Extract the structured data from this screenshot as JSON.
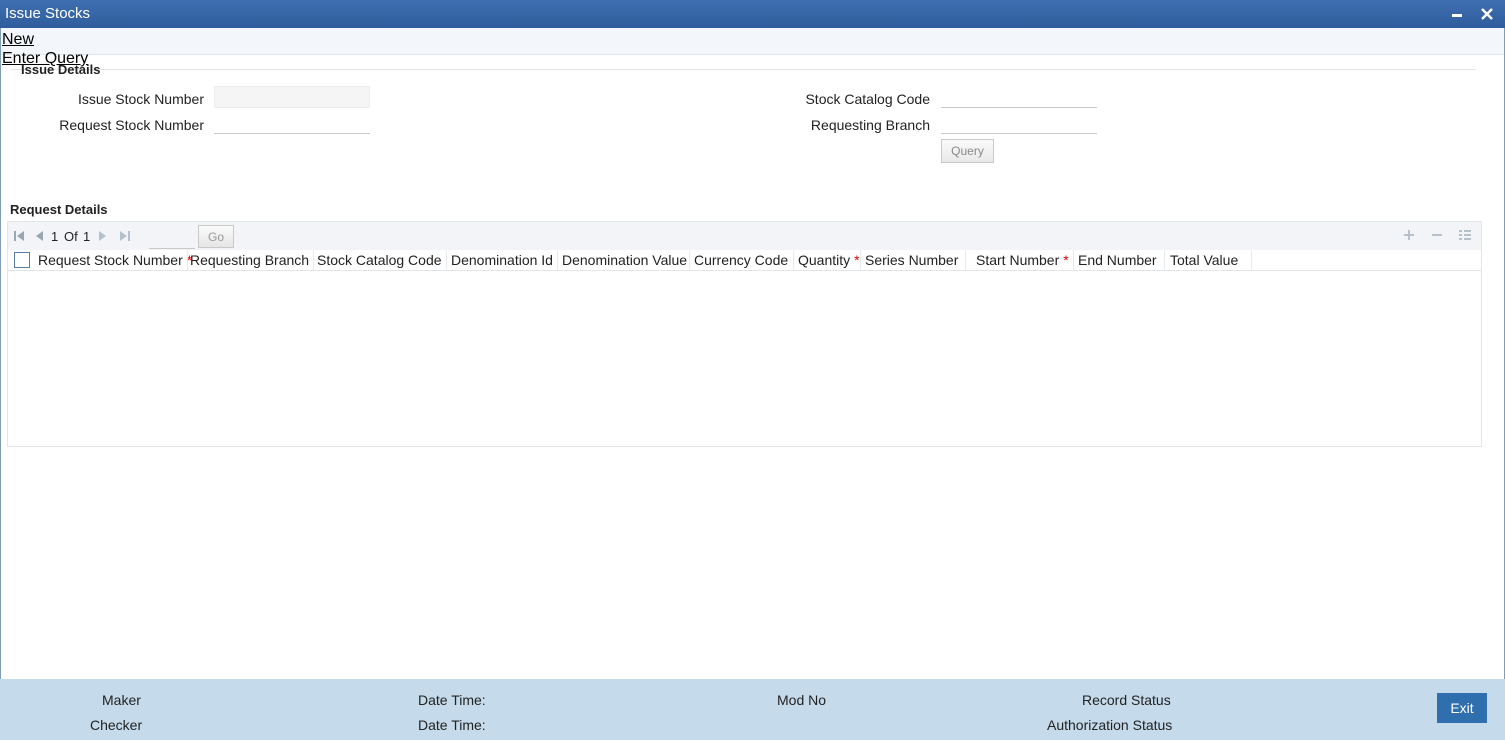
{
  "window": {
    "title": "Issue Stocks"
  },
  "menu": {
    "new": "New",
    "enter_query": "Enter Query"
  },
  "issue_details": {
    "legend": "Issue Details",
    "issue_stock_number_label": "Issue Stock Number",
    "issue_stock_number_value": "",
    "request_stock_number_label": "Request Stock Number",
    "request_stock_number_value": "",
    "stock_catalog_code_label": "Stock Catalog Code",
    "stock_catalog_code_value": "",
    "requesting_branch_label": "Requesting Branch",
    "requesting_branch_value": "",
    "query_button": "Query"
  },
  "request_details": {
    "title": "Request Details",
    "pager": {
      "current": "1",
      "of_label": "Of",
      "total": "1",
      "go": "Go"
    },
    "columns": [
      {
        "label": "Request Stock Number",
        "required": true
      },
      {
        "label": "Requesting Branch",
        "required": false
      },
      {
        "label": "Stock Catalog Code",
        "required": false
      },
      {
        "label": "Denomination Id",
        "required": false
      },
      {
        "label": "Denomination Value",
        "required": false
      },
      {
        "label": "Currency Code",
        "required": false
      },
      {
        "label": "Quantity",
        "required": true
      },
      {
        "label": "Series Number",
        "required": false
      },
      {
        "label": "Start Number",
        "required": true
      },
      {
        "label": "End Number",
        "required": false
      },
      {
        "label": "Total Value",
        "required": false
      }
    ],
    "rows": []
  },
  "footer": {
    "maker": "Maker",
    "checker": "Checker",
    "date_time_1": "Date Time:",
    "date_time_2": "Date Time:",
    "mod_no": "Mod No",
    "record_status": "Record Status",
    "authorization_status": "Authorization Status",
    "exit": "Exit"
  },
  "icons": {
    "minimize": "minimize-icon",
    "close": "close-icon",
    "first": "first-page-icon",
    "prev": "prev-page-icon",
    "next": "next-page-icon",
    "last": "last-page-icon",
    "add": "add-row-icon",
    "remove": "remove-row-icon",
    "columns": "columns-icon"
  },
  "colors": {
    "titlebar": "#2f5d9c",
    "footer": "#c5dbeb",
    "exit_button": "#2f6fae",
    "required": "#d00000"
  }
}
